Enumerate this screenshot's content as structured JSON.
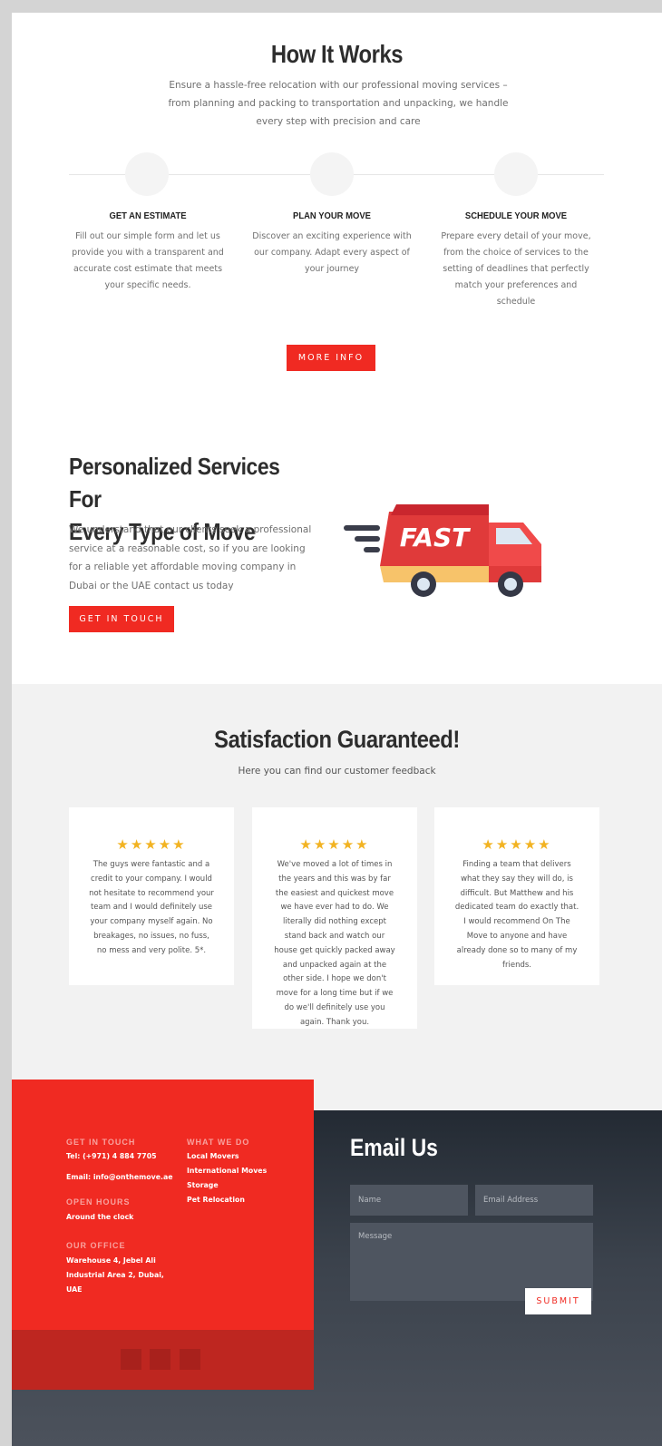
{
  "how_it_works": {
    "title": "How It Works",
    "subtitle": "Ensure a hassle-free relocation with our professional moving services – from planning and packing to transportation and unpacking, we handle every step with precision and care",
    "steps": [
      {
        "title": "GET AN ESTIMATE",
        "text": "Fill out our simple form and let us provide you with a transparent and accurate cost estimate that meets your specific needs."
      },
      {
        "title": "PLAN YOUR MOVE",
        "text": "Discover an exciting experience with our company. Adapt every aspect of your journey"
      },
      {
        "title": "SCHEDULE YOUR MOVE",
        "text": "Prepare every detail of your move, from the choice of services to the setting of deadlines that perfectly match your preferences and schedule"
      }
    ],
    "button": "MORE INFO"
  },
  "personalized": {
    "title_line1": "Personalized Services For",
    "title_line2": "Every Type of Move",
    "text": "We understand that our clients seek a professional service at a reasonable cost, so if you are looking for a reliable yet affordable moving company in Dubai or the UAE contact us today",
    "button": "GET IN TOUCH",
    "truck_label": "FAST"
  },
  "testimonials": {
    "title": "Satisfaction Guaranteed!",
    "subtitle": "Here you can find our customer feedback",
    "stars": "★★★★★",
    "cards": [
      {
        "text": "The guys were fantastic and a credit to your company. I would not hesitate to recommend your team and I would definitely use your company myself again. No breakages, no issues, no fuss, no mess and very polite. 5*."
      },
      {
        "text": "We've moved a lot of times in the years and this was by far the easiest and quickest move we have ever had to do.  We literally did nothing except stand back and watch our house get quickly packed away and unpacked again at the other side.  I hope we don't move for a long time but if we do we'll definitely use you again.  Thank you."
      },
      {
        "text": "Finding a team that delivers what they say they will do, is difficult. But Matthew and his dedicated team do exactly that. I would recommend On The Move to anyone and have already done so to many of my friends."
      }
    ]
  },
  "footer": {
    "get_in_touch_heading": "GET IN TOUCH",
    "tel": "Tel: (+971) 4 884 7705",
    "email": "Email: info@onthemove.ae",
    "open_hours_heading": "OPEN HOURS",
    "open_hours": "Around the clock",
    "office_heading": "OUR OFFICE",
    "office_line1": "Warehouse 4, Jebel Ali",
    "office_line2": "Industrial Area 2, Dubai,",
    "office_line3": "UAE",
    "what_we_do_heading": "WHAT WE DO",
    "services": [
      "Local Movers",
      "International Moves",
      "Storage",
      "Pet Relocation"
    ]
  },
  "email_form": {
    "title": "Email Us",
    "name_placeholder": "Name",
    "email_placeholder": "Email Address",
    "message_placeholder": "Message",
    "submit": "SUBMIT"
  },
  "colors": {
    "accent": "#f02a22",
    "star": "#f2b322",
    "footer_dark": "#2a3039"
  }
}
